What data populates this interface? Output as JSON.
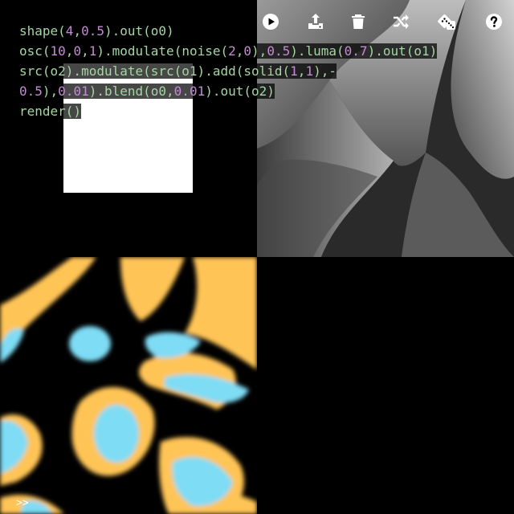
{
  "editor": {
    "lines": [
      [
        {
          "t": "shape(",
          "k": "c"
        },
        {
          "t": "4",
          "k": "n"
        },
        {
          "t": ",",
          "k": "c"
        },
        {
          "t": "0.5",
          "k": "n"
        },
        {
          "t": ").out(o0)",
          "k": "c"
        }
      ],
      [
        {
          "t": "osc(",
          "k": "c"
        },
        {
          "t": "10",
          "k": "n"
        },
        {
          "t": ",",
          "k": "c"
        },
        {
          "t": "0",
          "k": "n"
        },
        {
          "t": ",",
          "k": "c"
        },
        {
          "t": "1",
          "k": "n"
        },
        {
          "t": ").modulate(noise(",
          "k": "c"
        },
        {
          "t": "2",
          "k": "n"
        },
        {
          "t": ",",
          "k": "c"
        },
        {
          "t": "0",
          "k": "n"
        },
        {
          "t": "),",
          "k": "c"
        },
        {
          "t": "0.5",
          "k": "n"
        },
        {
          "t": ").luma(",
          "k": "c"
        },
        {
          "t": "0.7",
          "k": "n"
        },
        {
          "t": ").out(o1)",
          "k": "c"
        }
      ],
      [
        {
          "t": "src(o2).modulate(src(o1).add(solid(",
          "k": "c"
        },
        {
          "t": "1",
          "k": "n"
        },
        {
          "t": ",",
          "k": "c"
        },
        {
          "t": "1",
          "k": "n"
        },
        {
          "t": "),-",
          "k": "c"
        }
      ],
      [
        {
          "t": "0.5",
          "k": "n"
        },
        {
          "t": "),",
          "k": "c"
        },
        {
          "t": "0.01",
          "k": "n"
        },
        {
          "t": ").blend(o0,",
          "k": "c"
        },
        {
          "t": "0.01",
          "k": "n"
        },
        {
          "t": ").out(o2)",
          "k": "c"
        }
      ],
      [
        {
          "t": "render()",
          "k": "c"
        }
      ]
    ],
    "prompt": ">>"
  },
  "toolbar": {
    "buttons": [
      {
        "name": "run",
        "icon": "play-circle-icon"
      },
      {
        "name": "upload",
        "icon": "upload-icon"
      },
      {
        "name": "clear",
        "icon": "trash-icon"
      },
      {
        "name": "shuffle",
        "icon": "shuffle-icon"
      },
      {
        "name": "random",
        "icon": "dice-icon"
      },
      {
        "name": "help",
        "icon": "help-circle-icon"
      }
    ]
  },
  "colors": {
    "code_text": "#a4d6a2",
    "code_number": "#c48ad4",
    "blob_yellow": "#ffc457",
    "blob_cyan": "#7fdcf5"
  }
}
